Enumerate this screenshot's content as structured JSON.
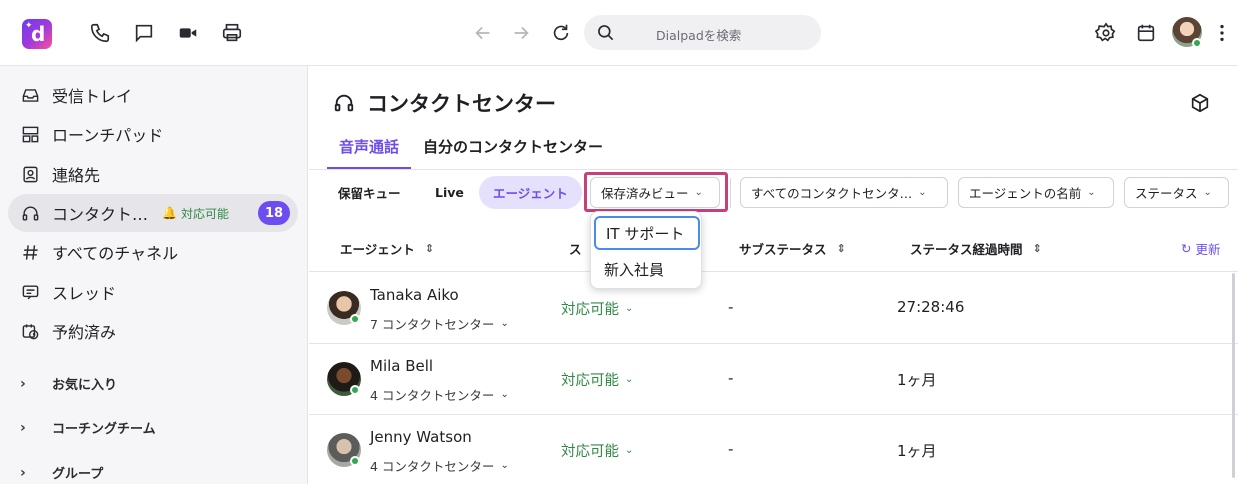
{
  "topbar": {
    "logo_letter": "d",
    "icons": [
      "phone-icon",
      "chat-icon",
      "video-icon",
      "printer-icon",
      "back-arrow-icon",
      "forward-arrow-icon",
      "reload-icon",
      "settings-icon",
      "calendar-icon",
      "more-icon"
    ],
    "search_placeholder": "Dialpadを検索"
  },
  "sidebar": {
    "items": [
      {
        "label": "受信トレイ",
        "icon": "inbox-icon"
      },
      {
        "label": "ローンチパッド",
        "icon": "launchpad-icon"
      },
      {
        "label": "連絡先",
        "icon": "contacts-icon"
      },
      {
        "label": "コンタクト…",
        "icon": "headset-icon",
        "status": "対応可能",
        "badge": "18"
      },
      {
        "label": "すべてのチャネル",
        "icon": "hash-icon"
      },
      {
        "label": "スレッド",
        "icon": "thread-icon"
      },
      {
        "label": "予約済み",
        "icon": "scheduled-icon"
      }
    ],
    "sections": [
      "お気に入り",
      "コーチングチーム",
      "グループ"
    ]
  },
  "main": {
    "title": "コンタクトセンター",
    "tabs": [
      "音声通話",
      "自分のコンタクトセンター"
    ],
    "chips": [
      "保留キュー",
      "Live",
      "エージェント"
    ],
    "saved_views_label": "保存済みビュー",
    "filters": [
      "すべてのコンタクトセンタ…",
      "エージェントの名前",
      "ステータス"
    ],
    "columns": [
      "エージェント",
      "ス",
      "サブステータス",
      "ステータス経過時間"
    ],
    "refresh_label": "更新",
    "rows": [
      {
        "name": "Tanaka Aiko",
        "centers": "7 コンタクトセンター",
        "status": "対応可能",
        "substatus": "-",
        "duration": "27:28:46"
      },
      {
        "name": "Mila Bell",
        "centers": "4 コンタクトセンター",
        "status": "対応可能",
        "substatus": "-",
        "duration": "1ヶ月"
      },
      {
        "name": "Jenny Watson",
        "centers": "4 コンタクトセンター",
        "status": "対応可能",
        "substatus": "-",
        "duration": "1ヶ月"
      }
    ]
  },
  "popup": {
    "options": [
      "IT サポート",
      "新入社員"
    ]
  },
  "colors": {
    "accent": "#6d4cf0",
    "available": "#2f8a44",
    "highlight": "#c8407a"
  }
}
